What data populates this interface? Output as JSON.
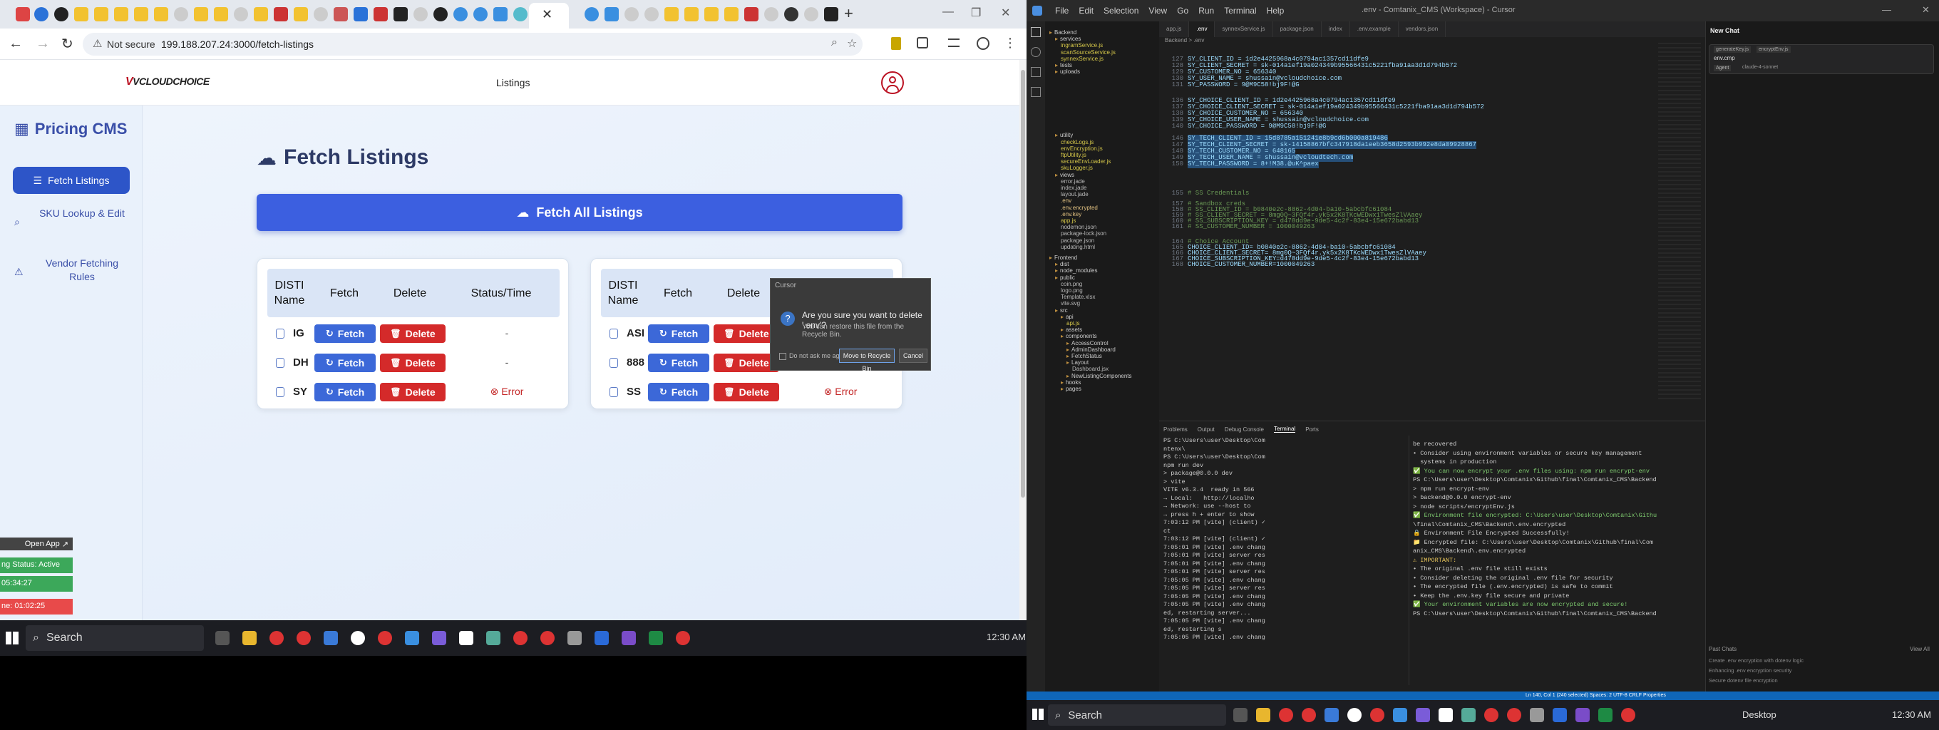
{
  "browser": {
    "address": "199.188.207.24:3000/fetch-listings",
    "not_secure": "Not secure"
  },
  "app": {
    "brand": "VCLOUDCHOICE",
    "nav_listings": "Listings",
    "sidebar_title": "Pricing CMS",
    "sidebar_items": [
      "Fetch Listings",
      "SKU Lookup & Edit",
      "Vendor Fetching Rules"
    ],
    "page_title": "Fetch Listings",
    "fetch_all": "Fetch All Listings",
    "headers": [
      "DISTI Name",
      "Fetch",
      "Delete",
      "Status/Time"
    ],
    "fetch_label": "Fetch",
    "delete_label": "Delete",
    "table1": [
      {
        "name": "IG",
        "status": "-"
      },
      {
        "name": "DH",
        "status": "-"
      },
      {
        "name": "SY",
        "status": "Error"
      }
    ],
    "table2": [
      {
        "name": "ASI",
        "status": "-"
      },
      {
        "name": "888",
        "status": "-"
      },
      {
        "name": "SS",
        "status": "Error"
      }
    ]
  },
  "overlay": {
    "open_app": "Open App",
    "status_active": "ng Status: Active",
    "time1": "05:34:27",
    "time2": "ne: 01:02:25"
  },
  "taskbar_left": {
    "search": "Search",
    "clock": "12:30 AM"
  },
  "taskbar_right": {
    "search": "Search",
    "desktop": "Desktop",
    "clock": "12:30 AM"
  },
  "vscode": {
    "menu": [
      "File",
      "Edit",
      "Selection",
      "View",
      "Go",
      "Run",
      "Terminal",
      "Help"
    ],
    "title": ".env - Comtanix_CMS (Workspace) - Cursor",
    "tabs": [
      "app.js",
      ".env",
      "synnexService.js",
      "package.json",
      "index",
      ".env.example",
      "vendors.json"
    ],
    "breadcrumb": "Backend > .env",
    "explorer": [
      "Backend",
      "services",
      "ingramService.js",
      "scanSourceService.js",
      "synnexService.js",
      "tests",
      "uploads",
      "utility",
      "checkLogs.js",
      "envEncryption.js",
      "ftpUtility.js",
      "secureEnvLoader.js",
      "skuLogger.js",
      "views",
      "error.jade",
      "index.jade",
      "layout.jade",
      ".env",
      ".env.encrypted",
      ".env.key",
      "app.js",
      "nodemon.json",
      "package-lock.json",
      "package.json",
      "updating.html",
      "Frontend",
      "dist",
      "node_modules",
      "public",
      "coin.png",
      "logo.png",
      "Template.xlsx",
      "vite.svg",
      "src",
      "api",
      "api.js",
      "assets",
      "components",
      "AccessControl",
      "AdminDashboard",
      "FetchStatus",
      "Layout",
      "Dashboard.jsx",
      "NewListingComponents",
      "hooks",
      "pages"
    ],
    "code": [
      {
        "n": "127",
        "t": "SY_CLIENT_ID = 1d2e4425968a4c0794ac1357cd11dfe9"
      },
      {
        "n": "128",
        "t": "SY_CLIENT_SECRET = sk-014a1ef19a024349b95566431c5221fba91aa3d1d794b572"
      },
      {
        "n": "129",
        "t": "SY_CUSTOMER_NO = 656340"
      },
      {
        "n": "130",
        "t": "SY_USER_NAME = shussain@vcloudchoice.com"
      },
      {
        "n": "131",
        "t": "SY_PASSWORD = 9@M9C58!bj9F!@G"
      },
      {
        "n": "136",
        "t": "SY_CHOICE_CLIENT_ID = 1d2e4425968a4c0794ac1357cd11dfe9"
      },
      {
        "n": "137",
        "t": "SY_CHOICE_CLIENT_SECRET = sk-014a1ef19a024349b95566431c5221fba91aa3d1d794b572"
      },
      {
        "n": "138",
        "t": "SY_CHOICE_CUSTOMER_NO = 656340"
      },
      {
        "n": "139",
        "t": "SY_CHOICE_USER_NAME = shussain@vcloudchoice.com"
      },
      {
        "n": "140",
        "t": "SY_CHOICE_PASSWORD = 9@M9C58!bj9F!@G"
      },
      {
        "n": "146",
        "t": "SY_TECH_CLIENT_ID = 15d8785a151241e8b9cd6b000a819486"
      },
      {
        "n": "147",
        "t": "SY_TECH_CLIENT_SECRET = sk-14158867bfc347918da1eeb3658d2593b992e8da09928867"
      },
      {
        "n": "148",
        "t": "SY_TECH_CUSTOMER_NO = 648165"
      },
      {
        "n": "149",
        "t": "SY_TECH_USER_NAME = shussain@vcloudtech.com"
      },
      {
        "n": "150",
        "t": "SY_TECH_PASSWORD = 8+!M38.@uK^paex"
      },
      {
        "n": "155",
        "t": "# SS Credentials"
      },
      {
        "n": "157",
        "t": "# Sandbox creds"
      },
      {
        "n": "158",
        "t": "# SS_CLIENT_ID = b0840e2c-8862-4d04-ba10-5abcbfc61084"
      },
      {
        "n": "159",
        "t": "# SS_CLIENT_SECRET = 8mg0Q~3FQf4r.yk5x2K8TKcWEDwx1TwesZlVAaey"
      },
      {
        "n": "160",
        "t": "# SS_SUBSCRIPTION_KEY = d478dd9e-9de5-4c2f-83e4-15e672babd13"
      },
      {
        "n": "161",
        "t": "# SS_CUSTOMER_NUMBER = 1000049263"
      },
      {
        "n": "164",
        "t": "# Choice Account"
      },
      {
        "n": "165",
        "t": "CHOICE_CLIENT_ID= b0840e2c-8862-4d04-ba10-5abcbfc61084"
      },
      {
        "n": "166",
        "t": "CHOICE_CLIENT_SECRET= 8mg0Q~3FQf4r.yk5x2K8TKcWEDwx1TwesZlVAaey"
      },
      {
        "n": "167",
        "t": "CHOICE_SUBSCRIPTION_KEY=d478dd9e-9de5-4c2f-83e4-15e672babd13"
      },
      {
        "n": "168",
        "t": "CHOICE_CUSTOMER_NUMBER=1000049263"
      }
    ],
    "dialog": {
      "title": "Cursor",
      "message": "Are you sure you want to delete '.env'?",
      "detail": "You can restore this file from the Recycle Bin.",
      "checkbox": "Do not ask me again",
      "primary": "Move to Recycle Bin",
      "cancel": "Cancel"
    },
    "panel_tabs": [
      "Problems",
      "Output",
      "Debug Console",
      "Terminal",
      "Ports"
    ],
    "term1": [
      "PS C:\\Users\\user\\Desktop\\Com",
      "ntenx\\",
      "PS C:\\Users\\user\\Desktop\\Com",
      "npm run dev",
      "> package@0.0.0 dev",
      "> vite",
      "VITE v6.3.4  ready in 566",
      "→ Local:   http://localho",
      "→ Network: use --host to",
      "→ press h + enter to show",
      "7:03:12 PM [vite] (client) ✓",
      "ct",
      "7:03:12 PM [vite] (client) ✓",
      "7:05:01 PM [vite] .env chang",
      "7:05:01 PM [vite] server res",
      "7:05:01 PM [vite] .env chang",
      "7:05:01 PM [vite] server res",
      "7:05:05 PM [vite] .env chang",
      "7:05:05 PM [vite] server res",
      "7:05:05 PM [vite] .env chang",
      "7:05:05 PM [vite] .env chang",
      "ed, restarting server...",
      "7:05:05 PM [vite] .env chang",
      "ed, restarting s",
      "7:05:05 PM [vite] .env chang"
    ],
    "term2": [
      "be recovered",
      "• Consider using environment variables or secure key management",
      "  systems in production",
      "✅ You can now encrypt your .env files using: npm run encrypt-env",
      "PS C:\\Users\\user\\Desktop\\Comtanix\\Github\\final\\Comtanix_CMS\\Backend",
      "> npm run encrypt-env",
      "> backend@0.0.0 encrypt-env",
      "> node scripts/encryptEnv.js",
      "✅ Environment file encrypted: C:\\Users\\user\\Desktop\\Comtanix\\Githu",
      "\\final\\Comtanix_CMS\\Backend\\.env.encrypted",
      "🔒 Environment File Encrypted Successfully!",
      "📁 Encrypted file: C:\\Users\\user\\Desktop\\Comtanix\\Github\\final\\Com",
      "anix_CMS\\Backend\\.env.encrypted",
      "⚠ IMPORTANT:",
      "• The original .env file still exists",
      "• Consider deleting the original .env file for security",
      "• The encrypted file (.env.encrypted) is safe to commit",
      "• Keep the .env.key file secure and private",
      "✅ Your environment variables are now encrypted and secure!",
      "PS C:\\Users\\user\\Desktop\\Comtanix\\Github\\final\\Comtanix_CMS\\Backend"
    ],
    "chat": {
      "header": "New Chat",
      "files": [
        "generateKey.js",
        "encryptEnv.js"
      ],
      "input_text": "env.cmp",
      "agent": "Agent",
      "model": "claude-4-sonnet",
      "past_title": "Past Chats",
      "view_all": "View All",
      "past": [
        "Create .env encryption with dotenv logic",
        "Enhancing .env encryption security",
        "Secure dotenv file encryption"
      ]
    },
    "statusbar": "Ln 140, Col 1 (240 selected)   Spaces: 2   UTF-8   CRLF   Properties"
  }
}
